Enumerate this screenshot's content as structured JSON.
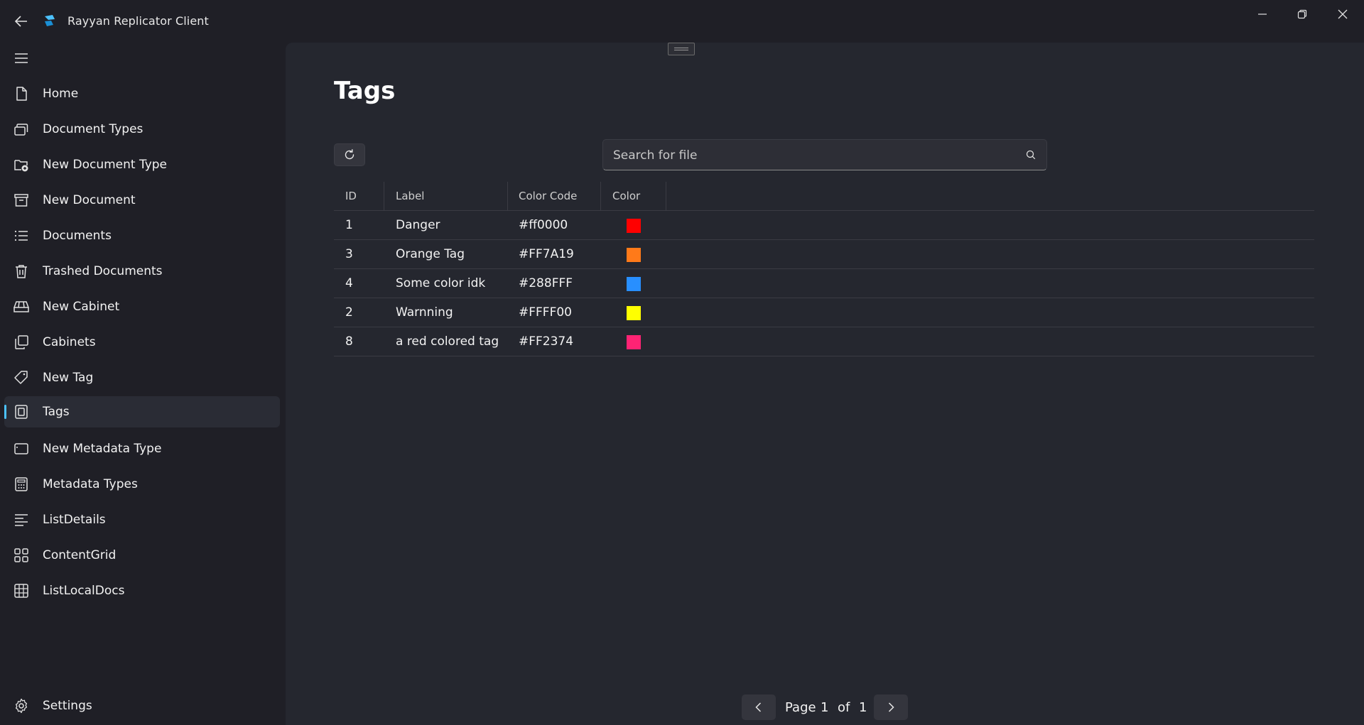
{
  "app": {
    "title": "Rayyan Replicator Client"
  },
  "sidebar": {
    "items": [
      {
        "label": "Home",
        "icon": "document-icon"
      },
      {
        "label": "Document Types",
        "icon": "stack-icon"
      },
      {
        "label": "New Document Type",
        "icon": "folder-add-icon"
      },
      {
        "label": "New Document",
        "icon": "archive-icon"
      },
      {
        "label": "Documents",
        "icon": "list-icon"
      },
      {
        "label": "Trashed Documents",
        "icon": "trash-icon"
      },
      {
        "label": "New Cabinet",
        "icon": "cabinet-icon"
      },
      {
        "label": "Cabinets",
        "icon": "copy-icon"
      },
      {
        "label": "New Tag",
        "icon": "tag-icon"
      },
      {
        "label": "Tags",
        "icon": "tags-icon"
      },
      {
        "label": "New Metadata Type",
        "icon": "rectangle-icon"
      },
      {
        "label": "Metadata Types",
        "icon": "calculator-icon"
      },
      {
        "label": "ListDetails",
        "icon": "lines-icon"
      },
      {
        "label": "ContentGrid",
        "icon": "grid-icon"
      },
      {
        "label": "ListLocalDocs",
        "icon": "table-icon"
      }
    ],
    "selected": "Tags",
    "settings_label": "Settings"
  },
  "main": {
    "title": "Tags",
    "search": {
      "placeholder": "Search for file",
      "value": ""
    },
    "table": {
      "columns": [
        "ID",
        "Label",
        "Color Code",
        "Color"
      ],
      "rows": [
        {
          "id": "1",
          "label": "Danger",
          "code": "#ff0000",
          "color": "#ff0000"
        },
        {
          "id": "3",
          "label": "Orange Tag",
          "code": "#FF7A19",
          "color": "#FF7A19"
        },
        {
          "id": "4",
          "label": "Some color idk",
          "code": "#288FFF",
          "color": "#288FFF"
        },
        {
          "id": "2",
          "label": "Warnning",
          "code": "#FFFF00",
          "color": "#FFFF00"
        },
        {
          "id": "8",
          "label": "a red colored tag",
          "code": "#FF2374",
          "color": "#FF2374"
        }
      ]
    },
    "pager": {
      "page_label": "Page",
      "current": "1",
      "of_label": "of",
      "total": "1"
    }
  },
  "colors": {
    "accent": "#4cc2ff",
    "background": "#1f1f26",
    "content": "#25272f"
  }
}
